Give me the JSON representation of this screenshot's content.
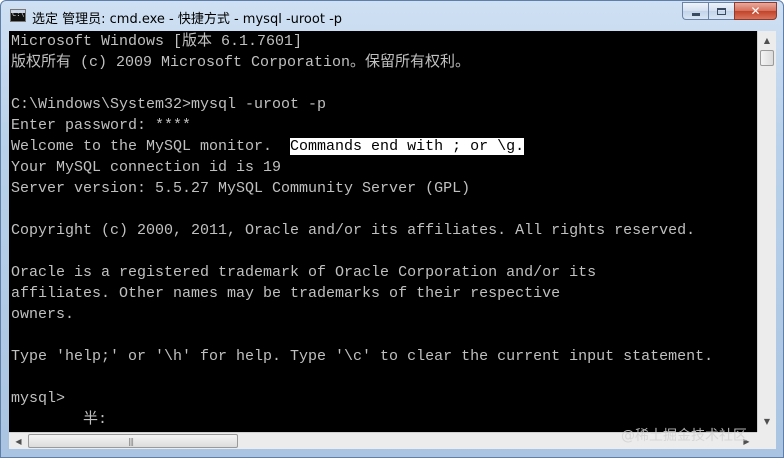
{
  "window": {
    "title": "选定 管理员: cmd.exe - 快捷方式 - mysql  -uroot -p",
    "icon": "cmd-icon",
    "minimize_icon": "minimize-icon",
    "maximize_icon": "maximize-icon",
    "close_glyph": "✕"
  },
  "console": {
    "lines": [
      "Microsoft Windows [版本 6.1.7601]",
      "版权所有 (c) 2009 Microsoft Corporation。保留所有权利。",
      "",
      "C:\\Windows\\System32>mysql -uroot -p",
      "Enter password: ****",
      "Welcome to the MySQL monitor.  ",
      "Your MySQL connection id is 19",
      "Server version: 5.5.27 MySQL Community Server (GPL)",
      "",
      "Copyright (c) 2000, 2011, Oracle and/or its affiliates. All rights reserved.",
      "",
      "Oracle is a registered trademark of Oracle Corporation and/or its",
      "affiliates. Other names may be trademarks of their respective",
      "owners.",
      "",
      "Type 'help;' or '\\h' for help. Type '\\c' to clear the current input statement.",
      "",
      "mysql>",
      "        半:"
    ],
    "selected_text": "Commands end with ; or \\g."
  },
  "scrollbars": {
    "up_glyph": "▲",
    "down_glyph": "▼",
    "left_glyph": "◀",
    "right_glyph": "▶",
    "grip": "|||"
  },
  "watermark": "@稀土掘金技术社区",
  "colors": {
    "console_bg": "#000000",
    "console_fg": "#c0c0c0",
    "selection_bg": "#ffffff",
    "close_button": "#c2432a"
  }
}
